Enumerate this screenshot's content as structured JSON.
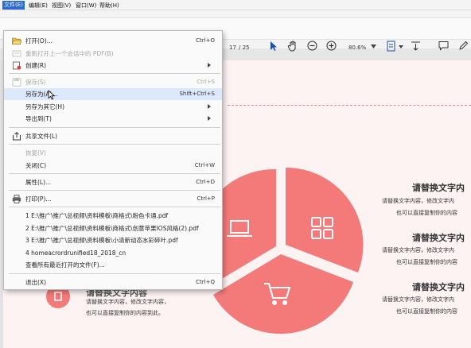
{
  "menubar": {
    "items": [
      "文件(E)",
      "编辑(E)",
      "视图(V)",
      "窗口(W)",
      "帮助(H)"
    ]
  },
  "toolbar": {
    "page_current": "17",
    "page_total": "/ 25",
    "zoom": "80.6%"
  },
  "file_menu": {
    "open": {
      "label": "打开(O)...",
      "shortcut": "Ctrl+O"
    },
    "reopen": {
      "label": "重新打开上一个会话中的 PDF(B)"
    },
    "create": {
      "label": "创建(R)"
    },
    "save": {
      "label": "保存(S)",
      "shortcut": "Ctrl+S"
    },
    "save_as": {
      "label": "另存为(A)...",
      "shortcut": "Shift+Ctrl+S"
    },
    "save_as_other": {
      "label": "另存为其它(H)"
    },
    "export_to": {
      "label": "导出到(T)"
    },
    "share": {
      "label": "共享文件(L)"
    },
    "revert": {
      "label": "恢复(V)"
    },
    "close": {
      "label": "关闭(C)",
      "shortcut": "Ctrl+W"
    },
    "properties": {
      "label": "属性(L)...",
      "shortcut": "Ctrl+D"
    },
    "print": {
      "label": "打印(P)...",
      "shortcut": "Ctrl+P"
    },
    "recent": [
      "1 E:\\推广\\推广\\总视频\\资料模板\\商格式\\粉色卡通.pdf",
      "2 E:\\推广\\推广\\总视频\\资料模板\\商格式\\创意苹果IOS风格(2).pdf",
      "3 E:\\推广\\推广\\总视频\\资料模板\\小清新动态水彩碎叶.pdf",
      "4 homeacrordrunified18_2018_cn",
      "查看所有最近打开的文件(F)..."
    ],
    "exit": {
      "label": "退出(X)",
      "shortcut": "Ctrl+Q"
    }
  },
  "slide": {
    "right_blocks": [
      {
        "title": "请替换文字内",
        "line1": "请替换文字内容，修改文字内",
        "line2": "也可以直接复制你的内容"
      },
      {
        "title": "请替换文字内",
        "line1": "请替换文字内容，修改文字内",
        "line2": "也可以直接复制你的内容"
      },
      {
        "title": "请替换文字内",
        "line1": "请替换文字内容，修改文字内",
        "line2": "也可以直接复制你的内容"
      }
    ],
    "left_block": {
      "title": "请替换文字内容",
      "line1": "请替换文字内容，修改文字内容，",
      "line2": "也可以直接复制你的内容到此。"
    }
  },
  "colors": {
    "accent": "#2a6bd1",
    "pie": "#f47a7a",
    "page_bg": "#fdf3f3",
    "dash": "#e88a8a"
  }
}
